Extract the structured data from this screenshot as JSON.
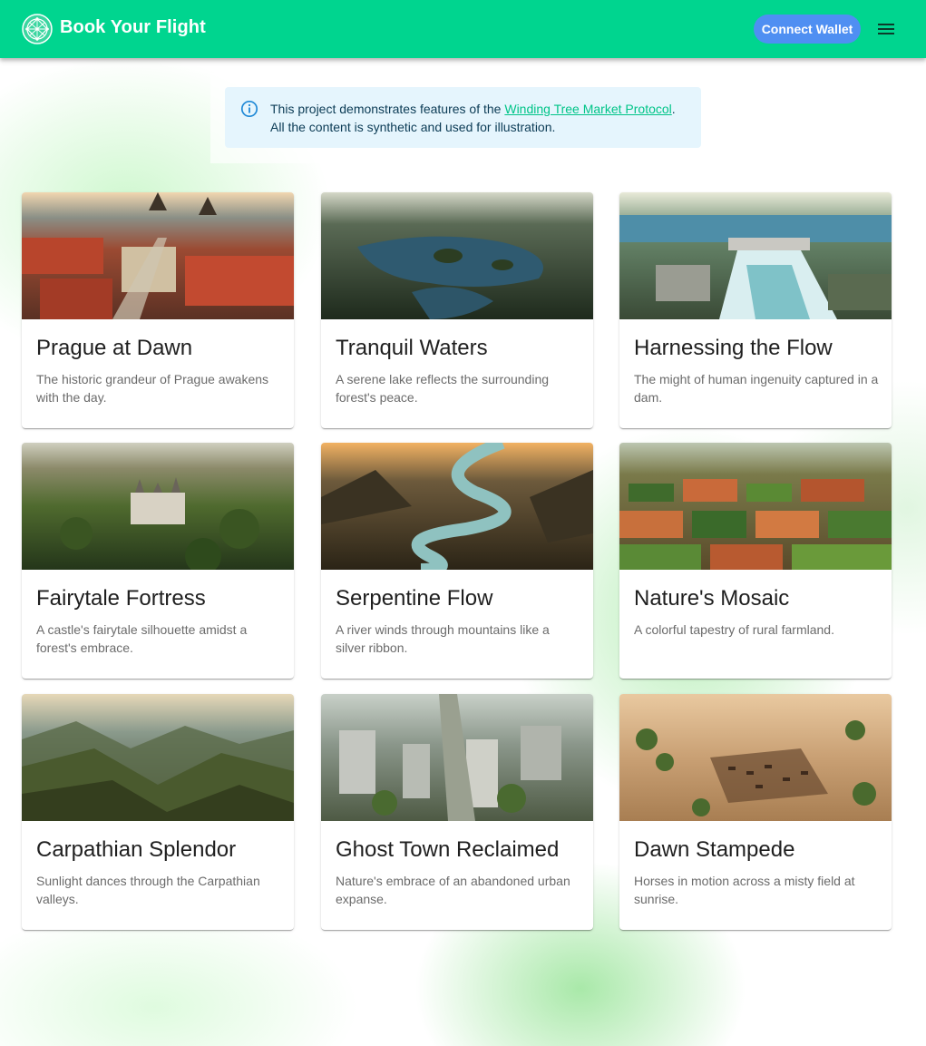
{
  "header": {
    "title": "Book Your Flight",
    "connect_label": "Connect Wallet",
    "logo_icon": "globe-network-icon",
    "menu_icon": "menu-icon",
    "bar_color": "#00d58f",
    "button_color": "#4f8ff2"
  },
  "notice": {
    "text_before": "This project demonstrates features of the ",
    "link_text": "Winding Tree Market Protocol",
    "text_after": ".",
    "line2": "All the content is synthetic and used for illustration.",
    "icon": "info-icon"
  },
  "cards": [
    {
      "title": "Prague at Dawn",
      "description": "The historic grandeur of Prague awakens with the day."
    },
    {
      "title": "Tranquil Waters",
      "description": "A serene lake reflects the surrounding forest's peace."
    },
    {
      "title": "Harnessing the Flow",
      "description": "The might of human ingenuity captured in a dam."
    },
    {
      "title": "Fairytale Fortress",
      "description": "A castle's fairytale silhouette amidst a forest's embrace."
    },
    {
      "title": "Serpentine Flow",
      "description": "A river winds through mountains like a silver ribbon."
    },
    {
      "title": "Nature's Mosaic",
      "description": "A colorful tapestry of rural farmland."
    },
    {
      "title": "Carpathian Splendor",
      "description": "Sunlight dances through the Carpathian valleys."
    },
    {
      "title": "Ghost Town Reclaimed",
      "description": "Nature's embrace of an abandoned urban expanse."
    },
    {
      "title": "Dawn Stampede",
      "description": "Horses in motion across a misty field at sunrise."
    }
  ]
}
